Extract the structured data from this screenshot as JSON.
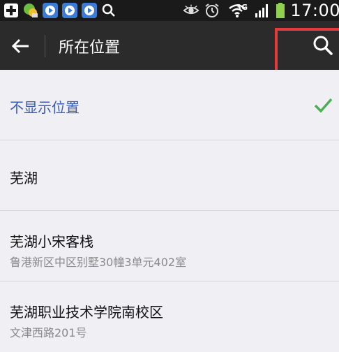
{
  "status_bar": {
    "network_label": "3G",
    "time": "17:00"
  },
  "header": {
    "title": "所在位置"
  },
  "locations": [
    {
      "name": "不显示位置",
      "address": "",
      "selected": true
    },
    {
      "name": "芜湖",
      "address": "",
      "selected": false
    },
    {
      "name": "芜湖小宋客栈",
      "address": "鲁港新区中区别墅30幢3单元402室",
      "selected": false
    },
    {
      "name": "芜湖职业技术学院南校区",
      "address": "文津西路201号",
      "selected": false
    }
  ],
  "colors": {
    "header_bg": "#2b2b2b",
    "selected_text": "#3c5bb3",
    "check": "#4caf50",
    "highlight_box": "#e23b3b"
  },
  "icons": [
    "add-icon",
    "app-icon",
    "video-icon",
    "search-icon",
    "eye-icon",
    "alarm-icon",
    "wifi-icon",
    "signal-icon",
    "battery-icon",
    "back-arrow-icon",
    "checkmark-icon"
  ]
}
